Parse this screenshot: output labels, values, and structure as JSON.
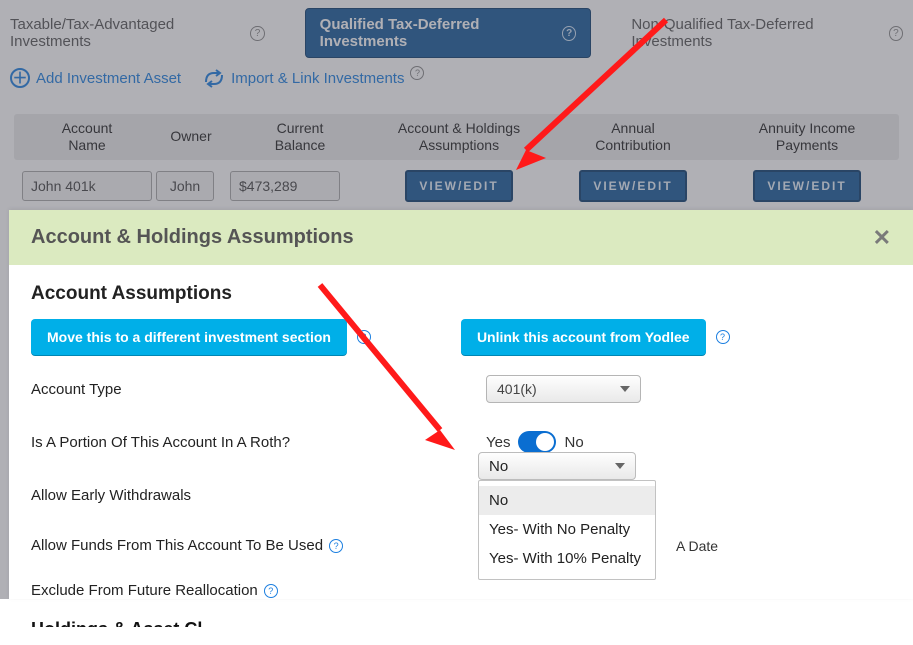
{
  "tabs": {
    "taxable": "Taxable/Tax-Advantaged Investments",
    "qualified": "Qualified Tax-Deferred Investments",
    "nonqualified": "Non-Qualified Tax-Deferred Investments"
  },
  "toolbar": {
    "add": "Add Investment Asset",
    "import": "Import & Link Investments"
  },
  "columns": {
    "c1a": "Account",
    "c1b": "Name",
    "c2": "Owner",
    "c3a": "Current",
    "c3b": "Balance",
    "c4a": "Account & Holdings",
    "c4b": "Assumptions",
    "c5a": "Annual",
    "c5b": "Contribution",
    "c6a": "Annuity Income",
    "c6b": "Payments"
  },
  "row": {
    "name": "John 401k",
    "owner": "John",
    "balance": "$473,289",
    "viewedit": "VIEW/EDIT"
  },
  "modal": {
    "title": "Account & Holdings Assumptions",
    "section": "Account Assumptions",
    "moveBtn": "Move this to a different investment section",
    "unlinkBtn": "Unlink this account from Yodlee",
    "labels": {
      "accountType": "Account Type",
      "roth": "Is A Portion Of This Account In A Roth?",
      "early": "Allow Early Withdrawals",
      "allowFunds": "Allow Funds From This Account To Be Used",
      "exclude": "Exclude From Future Reallocation"
    },
    "values": {
      "accountType": "401(k)",
      "yes": "Yes",
      "no": "No",
      "earlySelected": "No",
      "afterADate": "A Date"
    },
    "earlyOptions": [
      "No",
      "Yes- With No Penalty",
      "Yes- With 10% Penalty"
    ],
    "cutHeading": "Holdings & Asset Cl"
  }
}
